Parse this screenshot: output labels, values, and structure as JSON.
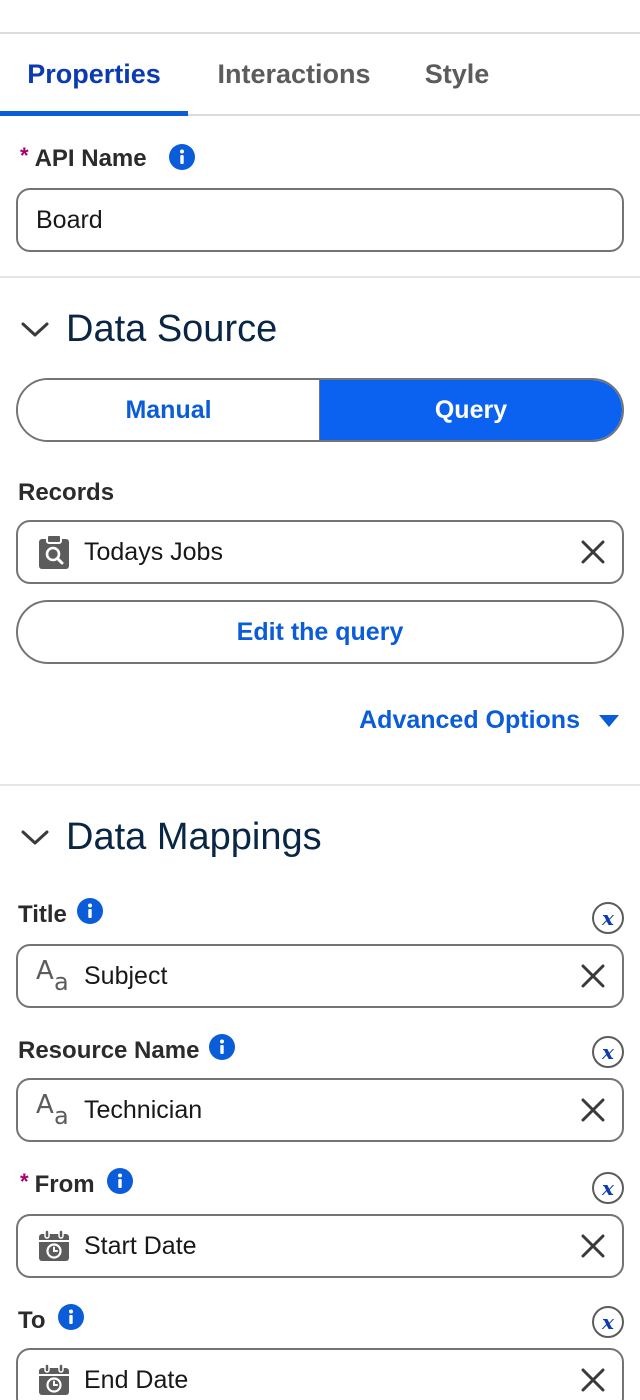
{
  "tabs": [
    {
      "label": "Properties",
      "active": true
    },
    {
      "label": "Interactions",
      "active": false
    },
    {
      "label": "Style",
      "active": false
    }
  ],
  "api_name": {
    "label": "API Name",
    "required": true,
    "value": "Board"
  },
  "data_source": {
    "title": "Data Source",
    "toggle": {
      "manual": "Manual",
      "query": "Query",
      "selected": "Query"
    },
    "records": {
      "label": "Records",
      "value": "Todays Jobs",
      "icon": "query-icon"
    },
    "edit_query_label": "Edit the query",
    "advanced_options_label": "Advanced Options"
  },
  "data_mappings": {
    "title": "Data Mappings",
    "fields": [
      {
        "label": "Title",
        "required": false,
        "value": "Subject",
        "icon": "text-icon"
      },
      {
        "label": "Resource Name",
        "required": false,
        "value": "Technician",
        "icon": "text-icon"
      },
      {
        "label": "From",
        "required": true,
        "value": "Start Date",
        "icon": "datetime-icon"
      },
      {
        "label": "To",
        "required": false,
        "value": "End Date",
        "icon": "datetime-icon"
      }
    ]
  },
  "colors": {
    "brand": "#0b5cd8",
    "active_tab": "#0b3ab1",
    "required": "#a4006d",
    "toggle_on": "#0b62f0"
  }
}
